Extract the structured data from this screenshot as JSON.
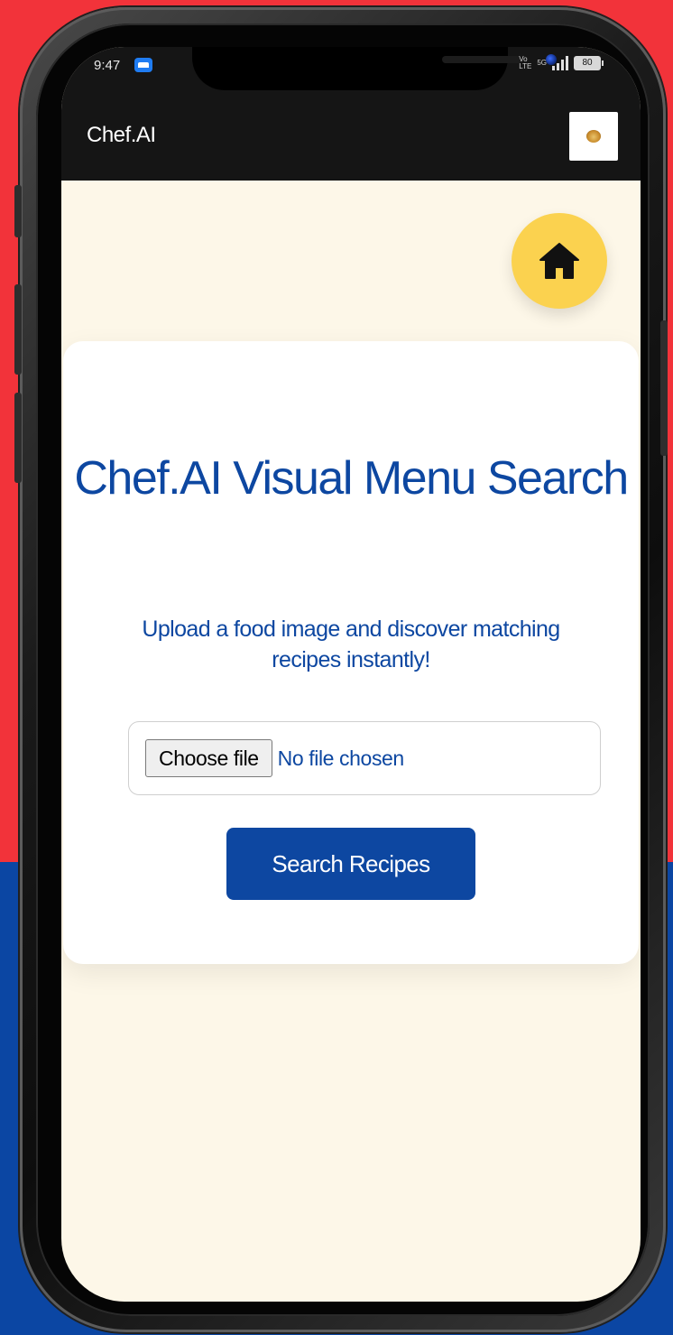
{
  "status_bar": {
    "time": "9:47",
    "network": "5G",
    "battery": "80"
  },
  "app_bar": {
    "title": "Chef.AI"
  },
  "home_button": {
    "icon": "home-icon",
    "color": "#fbd24f"
  },
  "card": {
    "title": "Chef.AI Visual Menu Search",
    "subtitle": "Upload a food image and discover matching recipes instantly!",
    "file_input": {
      "button_label": "Choose file",
      "status_text": "No file chosen"
    },
    "search_button_label": "Search Recipes"
  },
  "colors": {
    "primary": "#0d47a1",
    "accent": "#fbd24f",
    "background": "#fdf7e8",
    "app_bar": "#151515"
  }
}
